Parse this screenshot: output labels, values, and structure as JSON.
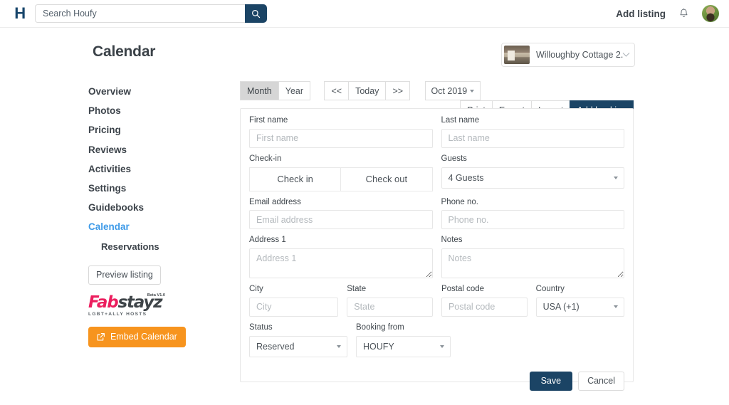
{
  "topbar": {
    "logo_text": "H",
    "search": {
      "value": "Search Houfy",
      "placeholder": "Search Houfy"
    },
    "search_icon": "search-icon",
    "add_listing_label": "Add listing",
    "bell_icon": "bell-icon",
    "avatar_label": "User avatar"
  },
  "page": {
    "title": "Calendar"
  },
  "property_selector": {
    "name": "Willoughby Cottage 2...",
    "chevron_icon": "chevron-down-icon"
  },
  "sidebar": {
    "items": [
      {
        "label": "Overview",
        "active": false
      },
      {
        "label": "Photos",
        "active": false
      },
      {
        "label": "Pricing",
        "active": false
      },
      {
        "label": "Reviews",
        "active": false
      },
      {
        "label": "Activities",
        "active": false
      },
      {
        "label": "Settings",
        "active": false
      },
      {
        "label": "Guidebooks",
        "active": false
      },
      {
        "label": "Calendar",
        "active": true
      }
    ],
    "sub_item": "Reservations",
    "preview_label": "Preview listing",
    "brand": {
      "part1": "Fab",
      "part2": "stayz",
      "beta": "Beta V1.0",
      "tagline": "LGBT+ALLY HOSTS"
    },
    "embed_label": "Embed Calendar",
    "embed_icon": "external-link-icon",
    "embed_color": "#f7941e"
  },
  "toolbar": {
    "view_buttons": [
      {
        "label": "Month",
        "active": true
      },
      {
        "label": "Year",
        "active": false
      }
    ],
    "nav_buttons": [
      {
        "label": "<<"
      },
      {
        "label": "Today"
      },
      {
        "label": ">>"
      }
    ],
    "month_select": {
      "value": "Oct 2019"
    },
    "right_buttons": [
      {
        "label": "Print",
        "active": false
      },
      {
        "label": "Export",
        "active": false
      },
      {
        "label": "Import",
        "active": false
      },
      {
        "label": "Add booking",
        "active": true
      }
    ],
    "accent_color": "#1b4465"
  },
  "form": {
    "first_name": {
      "label": "First name",
      "placeholder": "First name",
      "value": ""
    },
    "last_name": {
      "label": "Last name",
      "placeholder": "Last name",
      "value": ""
    },
    "checkin": {
      "label": "Check-in",
      "check_in_label": "Check in",
      "check_out_label": "Check out"
    },
    "guests": {
      "label": "Guests",
      "value": "4 Guests"
    },
    "email": {
      "label": "Email address",
      "placeholder": "Email address",
      "value": ""
    },
    "phone": {
      "label": "Phone no.",
      "placeholder": "Phone no.",
      "value": ""
    },
    "address1": {
      "label": "Address 1",
      "placeholder": "Address 1",
      "value": ""
    },
    "notes": {
      "label": "Notes",
      "placeholder": "Notes",
      "value": ""
    },
    "city": {
      "label": "City",
      "placeholder": "City",
      "value": ""
    },
    "state": {
      "label": "State",
      "placeholder": "State",
      "value": ""
    },
    "postal": {
      "label": "Postal code",
      "placeholder": "Postal code",
      "value": ""
    },
    "country": {
      "label": "Country",
      "value": "USA (+1)"
    },
    "status": {
      "label": "Status",
      "value": "Reserved"
    },
    "booking_from": {
      "label": "Booking from",
      "value": "HOUFY"
    },
    "save_label": "Save",
    "cancel_label": "Cancel"
  }
}
